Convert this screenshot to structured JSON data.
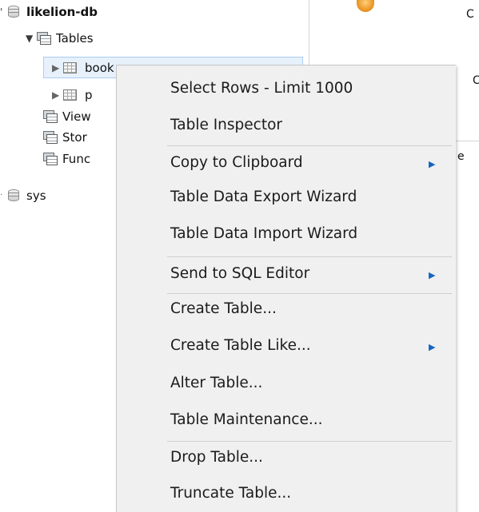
{
  "tree": {
    "schema_label": "likelion-db",
    "tables_label": "Tables",
    "table_book_label": "book",
    "table_second_label": "p",
    "views_label": "View",
    "stored_label": "Stor",
    "functions_label": "Func",
    "sys_label": "sys"
  },
  "right_pane": {
    "fragment_1": "C",
    "fragment_2": "C",
    "fragment_3": "e"
  },
  "context_menu": {
    "items": [
      {
        "label": "Select Rows - Limit 1000"
      },
      {
        "label": "Table Inspector"
      },
      {
        "label": "Copy to Clipboard",
        "submenu": true
      },
      {
        "label": "Table Data Export Wizard"
      },
      {
        "label": "Table Data Import Wizard"
      },
      {
        "label": "Send to SQL Editor",
        "submenu": true
      },
      {
        "label": "Create Table..."
      },
      {
        "label": "Create Table Like...",
        "submenu": true
      },
      {
        "label": "Alter Table..."
      },
      {
        "label": "Table Maintenance..."
      },
      {
        "label": "Drop Table..."
      },
      {
        "label": "Truncate Table..."
      }
    ],
    "submenu_indicator_icon": "submenu-arrow-icon",
    "accent_color": "#1565c0"
  }
}
